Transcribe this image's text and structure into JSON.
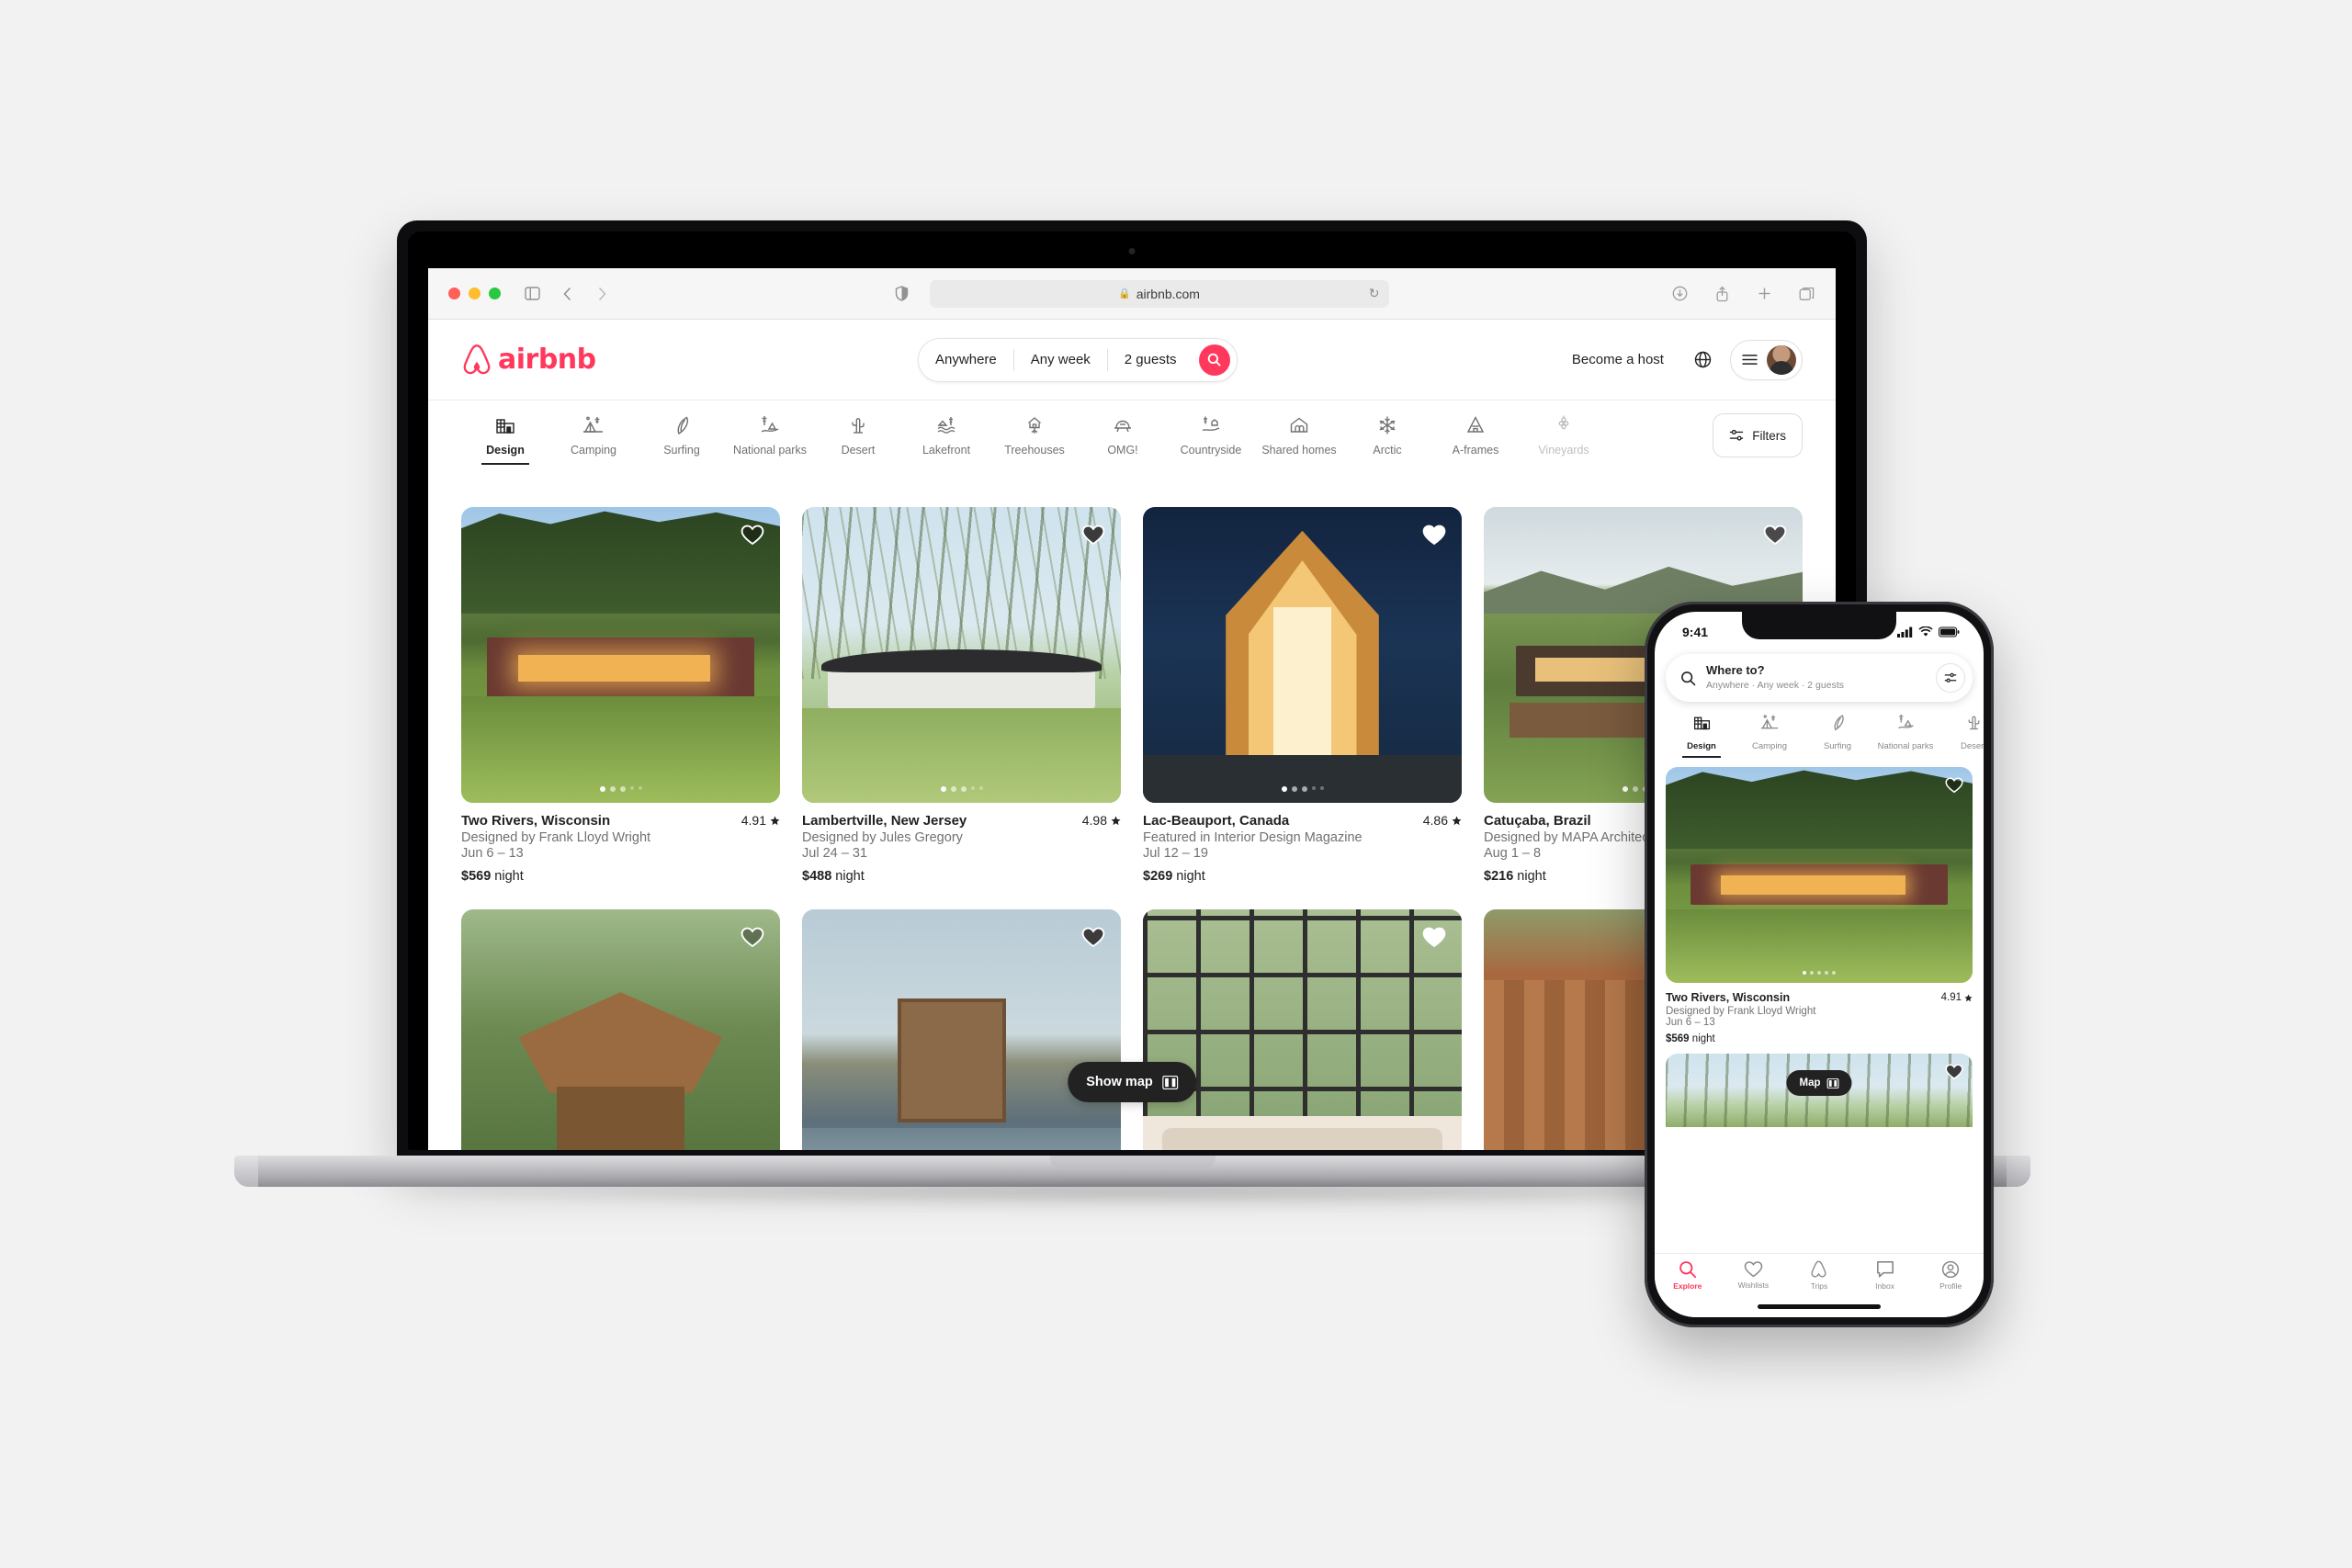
{
  "browser": {
    "url": "airbnb.com",
    "lock_icon": "lock-icon",
    "reload_icon": "reload-icon",
    "sidebar_icon": "sidebar-icon",
    "back_icon": "back-arrow-icon",
    "forward_icon": "forward-arrow-icon",
    "shield_icon": "privacy-shield-icon",
    "download_icon": "download-icon",
    "share_icon": "share-icon",
    "newtab_icon": "plus-icon",
    "tabs_icon": "tab-overview-icon"
  },
  "header": {
    "logo_text": "airbnb",
    "logo_color": "#FF385C",
    "search": {
      "where": "Anywhere",
      "when": "Any week",
      "who": "2 guests",
      "search_icon": "search-icon"
    },
    "become_host": "Become a host",
    "globe_icon": "globe-icon",
    "menu_icon": "hamburger-menu-icon",
    "avatar": "user-avatar"
  },
  "categories": [
    {
      "label": "Design",
      "icon": "design-icon",
      "state": "active"
    },
    {
      "label": "Camping",
      "icon": "camping-icon",
      "state": "normal"
    },
    {
      "label": "Surfing",
      "icon": "surfing-icon",
      "state": "normal"
    },
    {
      "label": "National parks",
      "icon": "national-parks-icon",
      "state": "normal"
    },
    {
      "label": "Desert",
      "icon": "desert-cactus-icon",
      "state": "normal"
    },
    {
      "label": "Lakefront",
      "icon": "lakefront-icon",
      "state": "normal"
    },
    {
      "label": "Treehouses",
      "icon": "treehouse-icon",
      "state": "normal"
    },
    {
      "label": "OMG!",
      "icon": "omg-icon",
      "state": "normal"
    },
    {
      "label": "Countryside",
      "icon": "countryside-icon",
      "state": "normal"
    },
    {
      "label": "Shared homes",
      "icon": "shared-homes-icon",
      "state": "normal"
    },
    {
      "label": "Arctic",
      "icon": "snowflake-icon",
      "state": "normal"
    },
    {
      "label": "A-frames",
      "icon": "a-frame-icon",
      "state": "normal"
    },
    {
      "label": "Vineyards",
      "icon": "vineyard-icon",
      "state": "faded"
    }
  ],
  "filters_button": {
    "label": "Filters",
    "icon": "filters-sliders-icon"
  },
  "listings": [
    {
      "title": "Two Rivers, Wisconsin",
      "rating": "4.91",
      "subtitle": "Designed by Frank Lloyd Wright",
      "dates": "Jun 6 – 13",
      "price": "$569",
      "price_unit": "night",
      "favorited": false,
      "dot_index": 0
    },
    {
      "title": "Lambertville, New Jersey",
      "rating": "4.98",
      "subtitle": "Designed by Jules Gregory",
      "dates": "Jul 24 – 31",
      "price": "$488",
      "price_unit": "night",
      "favorited": true,
      "dot_index": 0
    },
    {
      "title": "Lac-Beauport, Canada",
      "rating": "4.86",
      "subtitle": "Featured in Interior Design Magazine",
      "dates": "Jul 12 – 19",
      "price": "$269",
      "price_unit": "night",
      "favorited": true,
      "dot_index": 0
    },
    {
      "title": "Catuçaba, Brazil",
      "rating": "",
      "subtitle": "Designed by MAPA Architects",
      "dates": "Aug 1 – 8",
      "price": "$216",
      "price_unit": "night",
      "favorited": true,
      "dot_index": 0
    }
  ],
  "show_map_button": {
    "label": "Show map",
    "icon": "map-grid-icon"
  },
  "phone": {
    "status": {
      "time": "9:41",
      "cellular_icon": "cellular-bars-icon",
      "wifi_icon": "wifi-icon",
      "battery_icon": "battery-icon"
    },
    "search": {
      "title": "Where to?",
      "subtitle": "Anywhere · Any week · 2 guests",
      "search_icon": "search-icon",
      "filter_icon": "filters-sliders-icon"
    },
    "categories": [
      {
        "label": "Design",
        "icon": "design-icon",
        "state": "active"
      },
      {
        "label": "Camping",
        "icon": "camping-icon",
        "state": "normal"
      },
      {
        "label": "Surfing",
        "icon": "surfing-icon",
        "state": "normal"
      },
      {
        "label": "National parks",
        "icon": "national-parks-icon",
        "state": "normal"
      },
      {
        "label": "Desert",
        "icon": "desert-cactus-icon",
        "state": "normal"
      }
    ],
    "listing": {
      "title": "Two Rivers, Wisconsin",
      "rating": "4.91",
      "subtitle": "Designed by Frank Lloyd Wright",
      "dates": "Jun 6 – 13",
      "price": "$569",
      "price_unit": "night"
    },
    "map_button": {
      "label": "Map",
      "icon": "map-grid-icon"
    },
    "tabs": [
      {
        "label": "Explore",
        "icon": "search-icon",
        "state": "active"
      },
      {
        "label": "Wishlists",
        "icon": "heart-icon",
        "state": "normal"
      },
      {
        "label": "Trips",
        "icon": "airbnb-belo-icon",
        "state": "normal"
      },
      {
        "label": "Inbox",
        "icon": "message-icon",
        "state": "normal"
      },
      {
        "label": "Profile",
        "icon": "profile-icon",
        "state": "normal"
      }
    ]
  },
  "colors": {
    "brand": "#FF385C",
    "text": "#222222",
    "muted": "#717171",
    "page_bg": "#f2f2f2"
  }
}
